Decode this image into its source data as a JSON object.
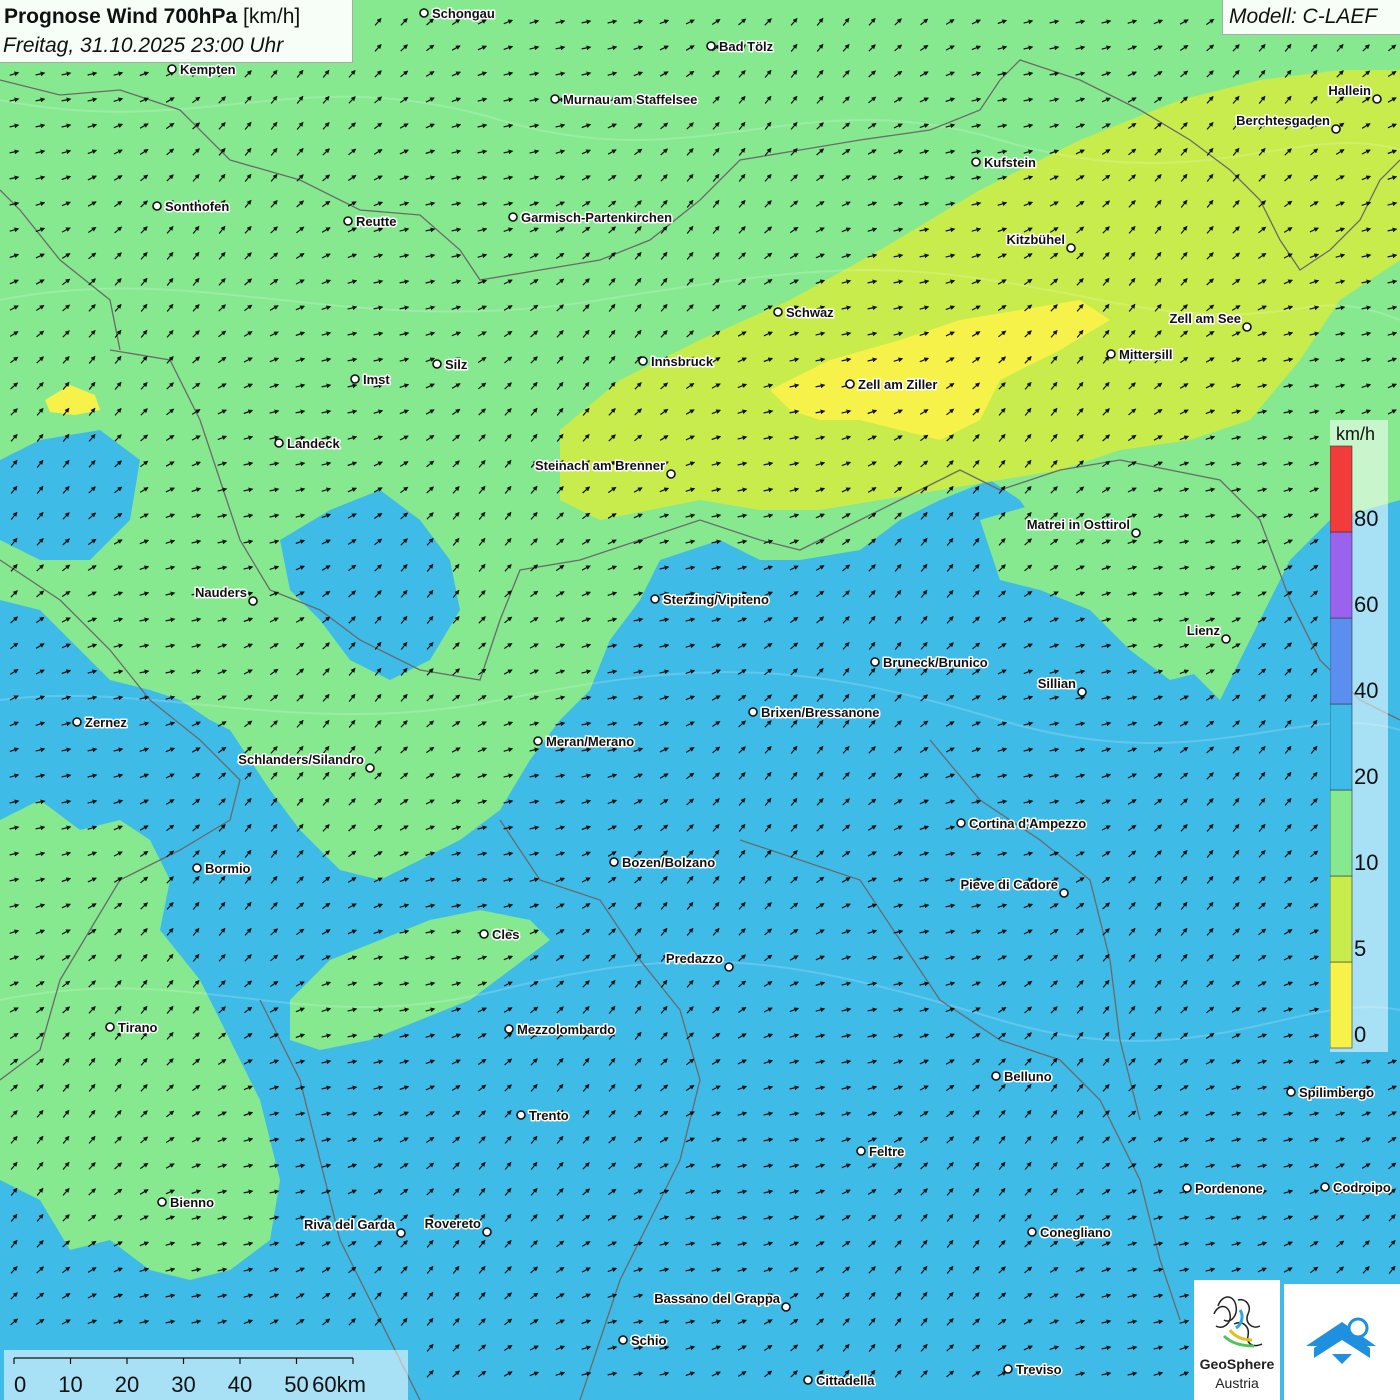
{
  "header": {
    "title_bold": "Prognose Wind 700hPa",
    "title_unit": "[km/h]",
    "subtitle": "Freitag, 31.10.2025 23:00 Uhr",
    "model": "Modell: C-LAEF"
  },
  "legend": {
    "unit": "km/h",
    "bins": [
      {
        "label": "0",
        "color": "#f7f24a"
      },
      {
        "label": "5",
        "color": "#c8ec4c"
      },
      {
        "label": "10",
        "color": "#86e98f"
      },
      {
        "label": "20",
        "color": "#3fbbe8"
      },
      {
        "label": "40",
        "color": "#5a8ff0"
      },
      {
        "label": "60",
        "color": "#9a63ee"
      },
      {
        "label": "80",
        "color": "#f23b3b"
      }
    ]
  },
  "scale_bar": {
    "ticks": [
      "0",
      "10",
      "20",
      "30",
      "40",
      "50",
      "60km"
    ]
  },
  "logo": {
    "name": "GeoSphere",
    "country": "Austria"
  },
  "cities": [
    {
      "name": "Schongau"
    },
    {
      "name": "Bad Tölz"
    },
    {
      "name": "Kempten"
    },
    {
      "name": "Murnau am Staffelsee"
    },
    {
      "name": "Hallein"
    },
    {
      "name": "Berchtesgaden"
    },
    {
      "name": "Kufstein"
    },
    {
      "name": "Sonthofen"
    },
    {
      "name": "Reutte"
    },
    {
      "name": "Garmisch-Partenkirchen"
    },
    {
      "name": "Kitzbühel"
    },
    {
      "name": "Schwaz"
    },
    {
      "name": "Zell am See"
    },
    {
      "name": "Innsbruck"
    },
    {
      "name": "Mittersill"
    },
    {
      "name": "Silz"
    },
    {
      "name": "Imst"
    },
    {
      "name": "Zell am Ziller"
    },
    {
      "name": "Landeck"
    },
    {
      "name": "Steinach am Brenner"
    },
    {
      "name": "Matrei in Osttirol"
    },
    {
      "name": "Nauders"
    },
    {
      "name": "Sterzing/Vipiteno"
    },
    {
      "name": "Lienz"
    },
    {
      "name": "Bruneck/Brunico"
    },
    {
      "name": "Sillian"
    },
    {
      "name": "Zernez"
    },
    {
      "name": "Brixen/Bressanone"
    },
    {
      "name": "Meran/Merano"
    },
    {
      "name": "Schlanders/Silandro"
    },
    {
      "name": "Cortina d'Ampezzo"
    },
    {
      "name": "Bozen/Bolzano"
    },
    {
      "name": "Bormio"
    },
    {
      "name": "Pieve di Cadore"
    },
    {
      "name": "Cles"
    },
    {
      "name": "Predazzo"
    },
    {
      "name": "Tirano"
    },
    {
      "name": "Mezzolombardo"
    },
    {
      "name": "Belluno"
    },
    {
      "name": "Spilimbergo"
    },
    {
      "name": "Trento"
    },
    {
      "name": "Feltre"
    },
    {
      "name": "Pordenone"
    },
    {
      "name": "Codroipo"
    },
    {
      "name": "Bienno"
    },
    {
      "name": "Riva del Garda"
    },
    {
      "name": "Rovereto"
    },
    {
      "name": "Conegliano"
    },
    {
      "name": "Bassano del Grappa"
    },
    {
      "name": "Schio"
    },
    {
      "name": "Treviso"
    },
    {
      "name": "Cittadella"
    }
  ]
}
